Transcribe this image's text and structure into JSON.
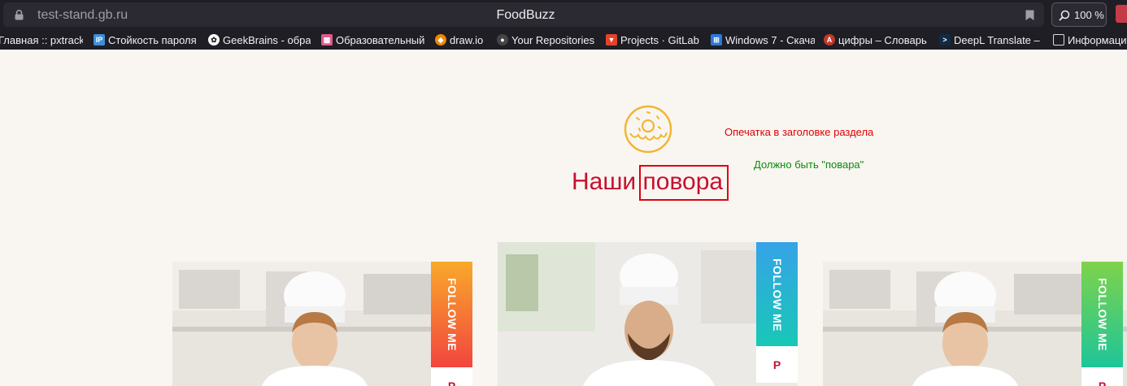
{
  "browser": {
    "url": "test-stand.gb.ru",
    "page_title": "FoodBuzz",
    "zoom": "100 %",
    "bookmarks": [
      {
        "label": "Главная :: pxtracke",
        "icon": "page-icon",
        "color": "#1f1e25"
      },
      {
        "label": "Стойкость пароля",
        "icon": "ip-icon",
        "color": "#3c8fd8"
      },
      {
        "label": "GeekBrains - обра",
        "icon": "geekbrains-icon",
        "color": "#333333"
      },
      {
        "label": "Образовательный",
        "icon": "education-icon",
        "color": "#e05a8a"
      },
      {
        "label": "draw.io",
        "icon": "drawio-icon",
        "color": "#f08705"
      },
      {
        "label": "Your Repositories",
        "icon": "github-icon",
        "color": "#444444"
      },
      {
        "label": "Projects · GitLab",
        "icon": "gitlab-icon",
        "color": "#e24329"
      },
      {
        "label": "Windows 7 - Скача",
        "icon": "windows-icon",
        "color": "#2a7bd8"
      },
      {
        "label": "цифры – Словарь",
        "icon": "dictionary-icon",
        "color": "#c0392b"
      },
      {
        "label": "DeepL Translate –",
        "icon": "deepl-icon",
        "color": "#0f2b46"
      },
      {
        "label": "Информаци",
        "icon": "document-icon",
        "color": "#1f1e25"
      }
    ]
  },
  "section": {
    "title_part1": "Наши",
    "title_part2": "повора"
  },
  "annotations": {
    "typo_note": "Опечатка в заголовке раздела",
    "fix_note": "Должно быть \"повара\""
  },
  "cards": [
    {
      "follow_label": "FOLLOW ME",
      "pin_glyph": "P",
      "gradient": [
        "#f9a92a",
        "#f2453f"
      ]
    },
    {
      "follow_label": "FOLLOW ME",
      "pin_glyph": "P",
      "gradient": [
        "#36a3e8",
        "#18c8b5"
      ]
    },
    {
      "follow_label": "FOLLOW ME",
      "pin_glyph": "P",
      "gradient": [
        "#7ed34a",
        "#1ec59a"
      ]
    }
  ],
  "colors": {
    "title": "#c8102e",
    "highlight_box": "#e0000f",
    "typo_note": "#e00000",
    "fix_note": "#0a8a0a",
    "page_bg": "#f9f6f1"
  }
}
